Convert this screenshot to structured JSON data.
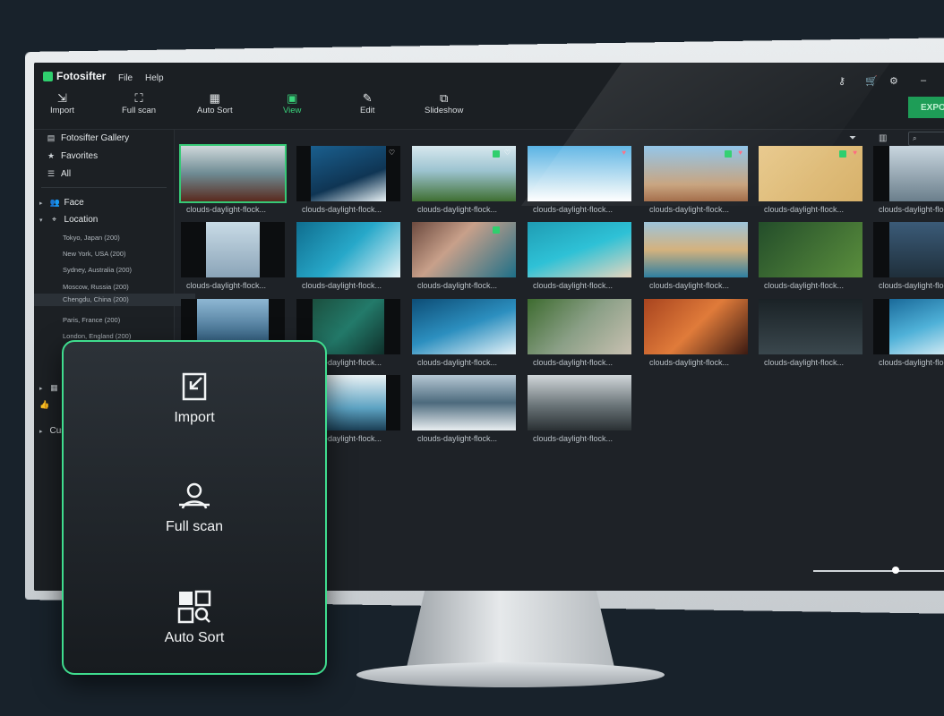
{
  "app": {
    "name": "Fotosifter"
  },
  "menu": [
    "File",
    "Help"
  ],
  "toolbar": {
    "tools": [
      {
        "label": "Import",
        "icon": "import-icon"
      },
      {
        "label": "Full scan",
        "icon": "full-scan-icon"
      },
      {
        "label": "Auto Sort",
        "icon": "auto-sort-icon"
      },
      {
        "label": "View",
        "icon": "view-icon",
        "active": true
      },
      {
        "label": "Edit",
        "icon": "edit-wand-icon"
      },
      {
        "label": "Slideshow",
        "icon": "slideshow-icon"
      }
    ],
    "export_label": "EXPO"
  },
  "sidebar": {
    "top_items": [
      {
        "label": "Fotosifter Gallery",
        "icon": "gallery-icon"
      },
      {
        "label": "Favorites",
        "icon": "star-icon"
      },
      {
        "label": "All",
        "icon": "list-icon"
      }
    ],
    "face_label": "Face",
    "location_label": "Location",
    "locations": [
      "Tokyo, Japan (200)",
      "New York, USA (200)",
      "Sydney, Australia (200)",
      "Moscow, Russia (200)",
      "Chengdu, China (200)",
      "Paris, France (200)",
      "London, England (200)"
    ],
    "selected_location_index": 4,
    "custom_label": "Cus"
  },
  "photos": {
    "caption": "clouds-daylight-flock...",
    "count": 25
  },
  "overlay": {
    "items": [
      {
        "label": "Import",
        "icon": "import-icon"
      },
      {
        "label": "Full scan",
        "icon": "full-scan-icon"
      },
      {
        "label": "Auto Sort",
        "icon": "auto-sort-icon"
      }
    ]
  },
  "colors": {
    "accent": "#2fcf6e",
    "card_border": "#3fdc8e",
    "background": "#18222b"
  }
}
